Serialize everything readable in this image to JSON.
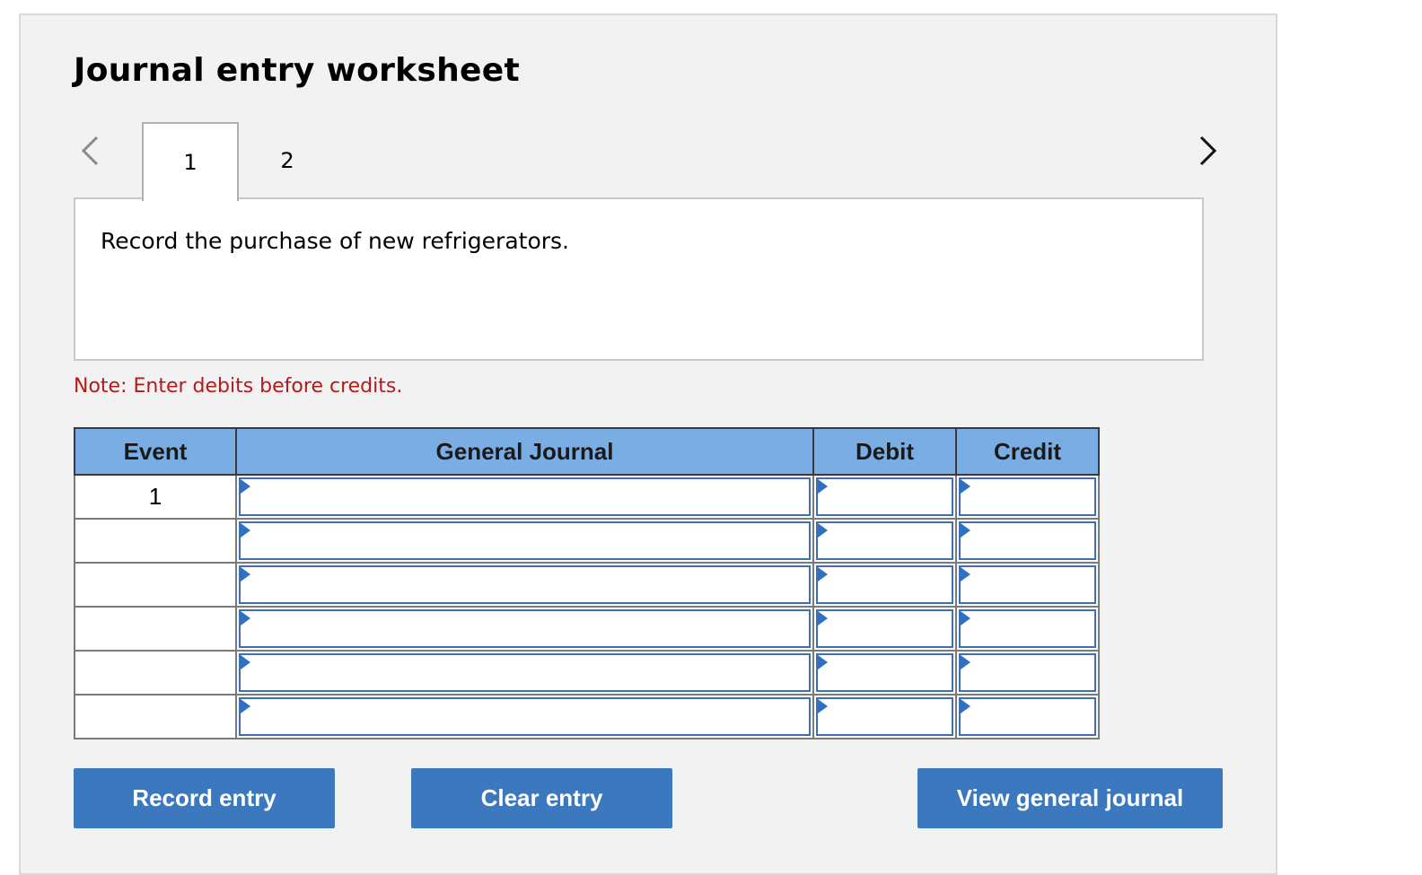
{
  "worksheet": {
    "title": "Journal entry worksheet",
    "tabs": [
      {
        "label": "1",
        "active": true
      },
      {
        "label": "2",
        "active": false
      }
    ],
    "nav_prev_icon": "chevron-left-icon",
    "nav_next_icon": "chevron-right-icon"
  },
  "question": {
    "text": "Record the purchase of new refrigerators."
  },
  "note": "Note: Enter debits before credits.",
  "table": {
    "headers": {
      "event": "Event",
      "general_journal": "General Journal",
      "debit": "Debit",
      "credit": "Credit"
    },
    "rows": [
      {
        "event": "1",
        "account": "",
        "debit": "",
        "credit": ""
      },
      {
        "event": "",
        "account": "",
        "debit": "",
        "credit": ""
      },
      {
        "event": "",
        "account": "",
        "debit": "",
        "credit": ""
      },
      {
        "event": "",
        "account": "",
        "debit": "",
        "credit": ""
      },
      {
        "event": "",
        "account": "",
        "debit": "",
        "credit": ""
      },
      {
        "event": "",
        "account": "",
        "debit": "",
        "credit": ""
      }
    ]
  },
  "buttons": {
    "record": "Record entry",
    "clear": "Clear entry",
    "view": "View general journal"
  },
  "colors": {
    "header_bg": "#7aade3",
    "button_bg": "#3b78bd",
    "note_text": "#b31b1b",
    "input_border": "#3f6fb0"
  }
}
